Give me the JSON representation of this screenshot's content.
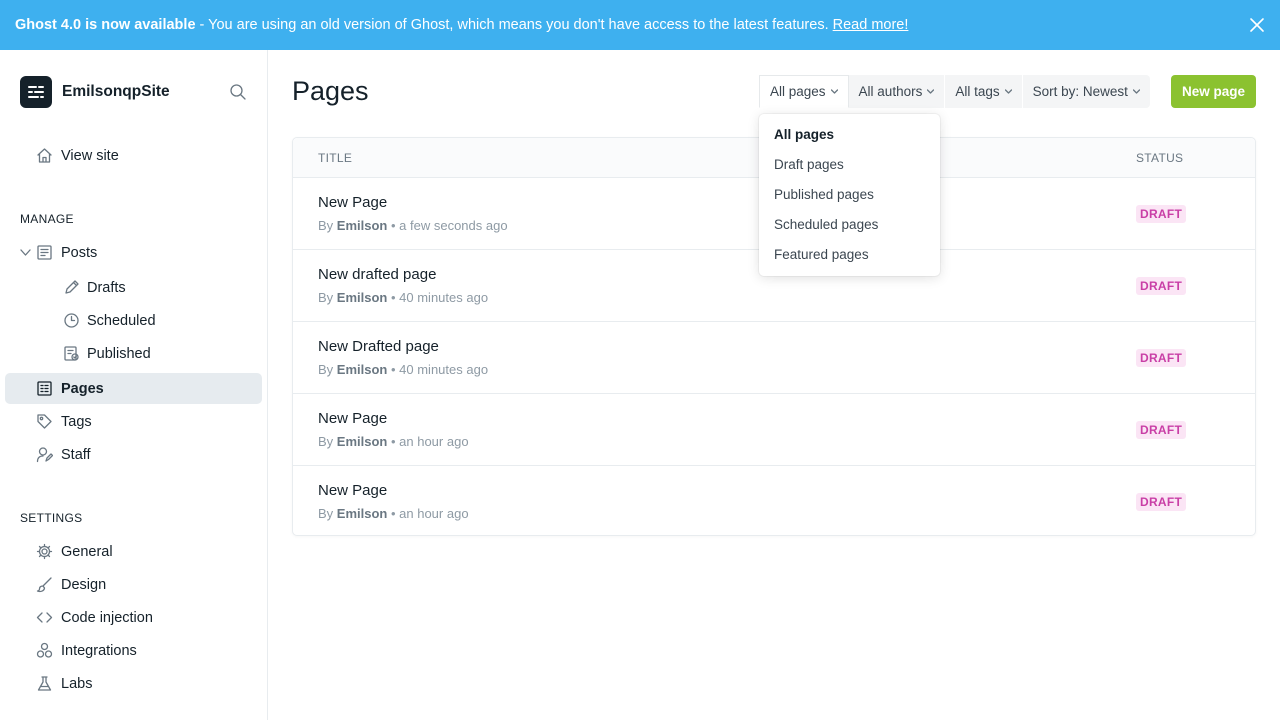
{
  "banner": {
    "title": "Ghost 4.0 is now available",
    "message": " - You are using an old version of Ghost, which means you don't have access to the latest features. ",
    "link": "Read more!",
    "close_icon": "close-icon",
    "bg_color": "#3eb0ef"
  },
  "sidebar": {
    "site_name": "EmilsonqpSite",
    "view_site": "View site",
    "manage_heading": "MANAGE",
    "settings_heading": "SETTINGS",
    "posts": "Posts",
    "drafts": "Drafts",
    "scheduled": "Scheduled",
    "published": "Published",
    "pages": "Pages",
    "tags": "Tags",
    "staff": "Staff",
    "general": "General",
    "design": "Design",
    "code_injection": "Code injection",
    "integrations": "Integrations",
    "labs": "Labs"
  },
  "main": {
    "title": "Pages",
    "new_button": "New page",
    "accent_color": "#8bc230",
    "filters": {
      "type": "All pages",
      "author": "All authors",
      "tag": "All tags",
      "sort": "Sort by: Newest"
    },
    "dropdown": [
      "All pages",
      "Draft pages",
      "Published pages",
      "Scheduled pages",
      "Featured pages"
    ],
    "table": {
      "col_title": "TITLE",
      "col_status": "STATUS",
      "rows": [
        {
          "title": "New Page",
          "by": "By ",
          "author": "Emilson",
          "time": " • a few seconds ago",
          "status": "DRAFT"
        },
        {
          "title": "New drafted page",
          "by": "By ",
          "author": "Emilson",
          "time": " • 40 minutes ago",
          "status": "DRAFT"
        },
        {
          "title": "New Drafted page",
          "by": "By ",
          "author": "Emilson",
          "time": " • 40 minutes ago",
          "status": "DRAFT"
        },
        {
          "title": "New Page",
          "by": "By ",
          "author": "Emilson",
          "time": " • an hour ago",
          "status": "DRAFT"
        },
        {
          "title": "New Page",
          "by": "By ",
          "author": "Emilson",
          "time": " • an hour ago",
          "status": "DRAFT"
        }
      ]
    }
  }
}
